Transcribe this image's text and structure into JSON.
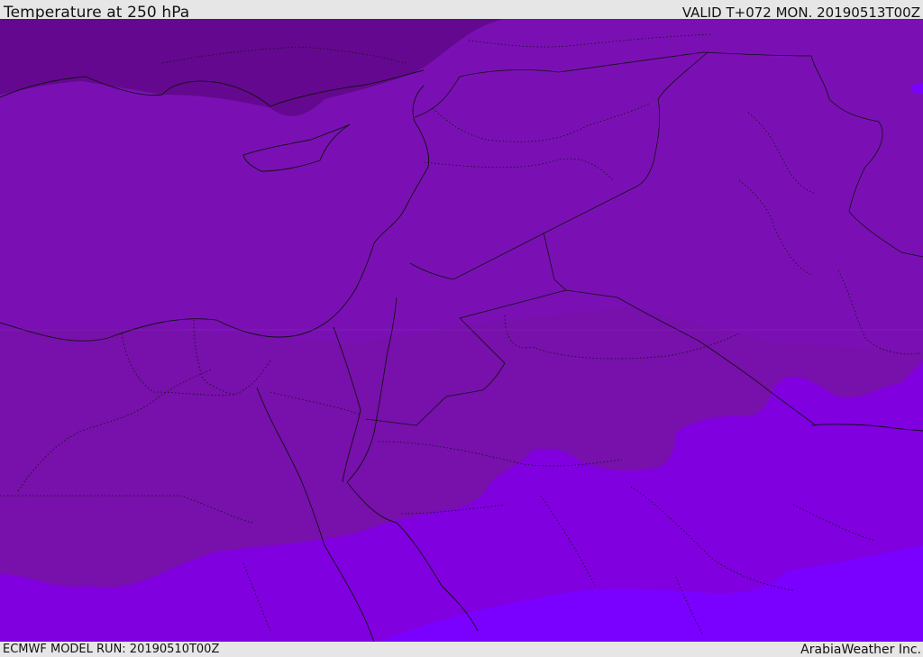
{
  "header": {
    "title": "Temperature at 250 hPa",
    "valid_time": "VALID T+072 MON. 20190513T00Z"
  },
  "footer": {
    "model_run": "ECMWF MODEL RUN: 20190510T00Z",
    "credit": "ArabiaWeather Inc."
  },
  "map": {
    "field": "temperature",
    "level": "250 hPa",
    "shading_colors": {
      "dark_violet": "#650890",
      "violet": "#7a10b4",
      "deep_purple": "#7810ac",
      "bright_purple": "#8000e0",
      "vivid_purple": "#7a00ff"
    },
    "boundary_color": "#111111"
  }
}
